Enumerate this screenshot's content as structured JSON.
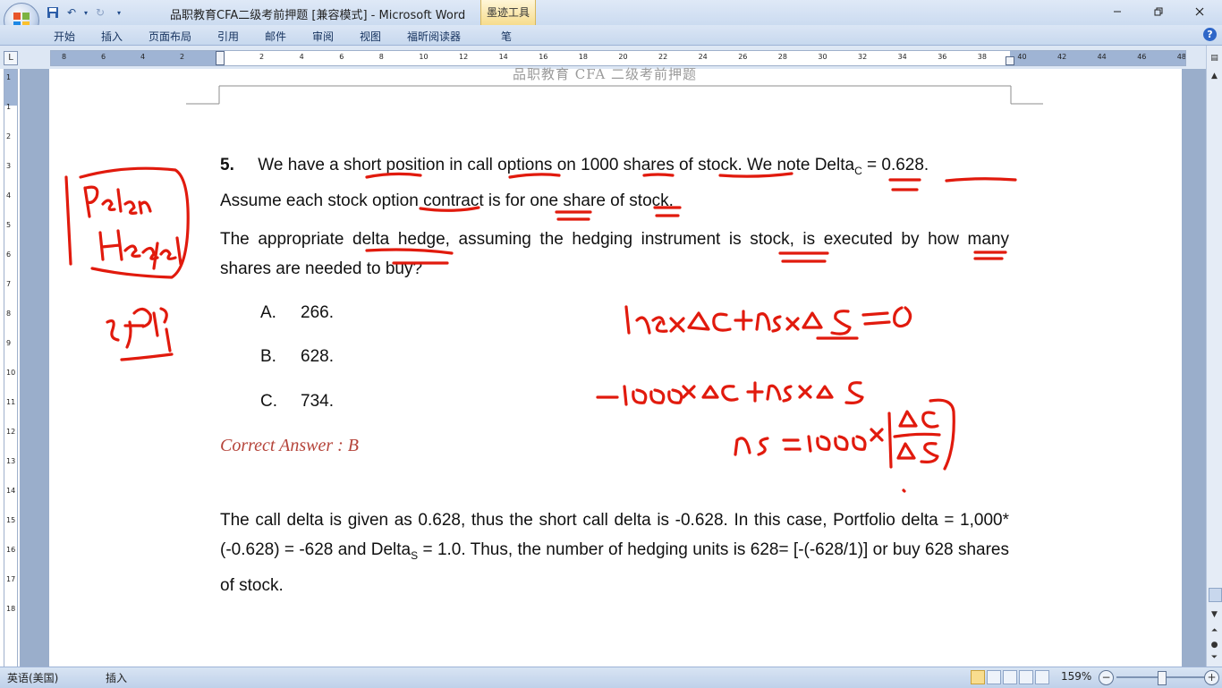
{
  "window": {
    "title": "品职教育CFA二级考前押题 [兼容模式] - Microsoft Word",
    "contextual_tab": "墨迹工具"
  },
  "ribbon_tabs": [
    "开始",
    "插入",
    "页面布局",
    "引用",
    "邮件",
    "审阅",
    "视图",
    "福昕阅读器",
    "笔"
  ],
  "ruler": {
    "h_numbers": [
      "8",
      "6",
      "4",
      "2",
      "2",
      "4",
      "6",
      "8",
      "10",
      "12",
      "14",
      "16",
      "18",
      "20",
      "22",
      "24",
      "26",
      "28",
      "30",
      "32",
      "34",
      "36",
      "38",
      "40",
      "42",
      "44",
      "46",
      "48"
    ],
    "v_numbers": [
      "1",
      "1",
      "2",
      "3",
      "4",
      "5",
      "6",
      "7",
      "8",
      "9",
      "10",
      "11",
      "12",
      "13",
      "14",
      "15",
      "16",
      "17",
      "18"
    ]
  },
  "document": {
    "header": "品职教育 CFA 二级考前押题",
    "q_number": "5.",
    "q_line1_a": "We have a short position in call options on 1000 shares of stock. We note Delta",
    "q_line1_sub": "C",
    "q_line1_b": " = 0.628.",
    "q_line2": "Assume each stock option contract is for one share of stock.",
    "q_para2": "The appropriate delta hedge, assuming the hedging instrument is stock, is executed by how many shares are needed to buy?",
    "options": [
      {
        "letter": "A.",
        "text": "266."
      },
      {
        "letter": "B.",
        "text": "628."
      },
      {
        "letter": "C.",
        "text": "734."
      }
    ],
    "correct_answer": "Correct Answer : B",
    "explanation_a": "The call delta is given as 0.628, thus the short call delta is -0.628. In this case, Portfolio delta = 1,000*(-0.628) = -628 and Delta",
    "explanation_sub": "S",
    "explanation_b": " = 1.0. Thus, the number of hedging units is 628= [-(-628/1)] or buy 628 shares of stock."
  },
  "ink_color": "#e11a0d",
  "statusbar": {
    "language": "英语(美国)",
    "mode": "插入",
    "zoom": "159%"
  }
}
